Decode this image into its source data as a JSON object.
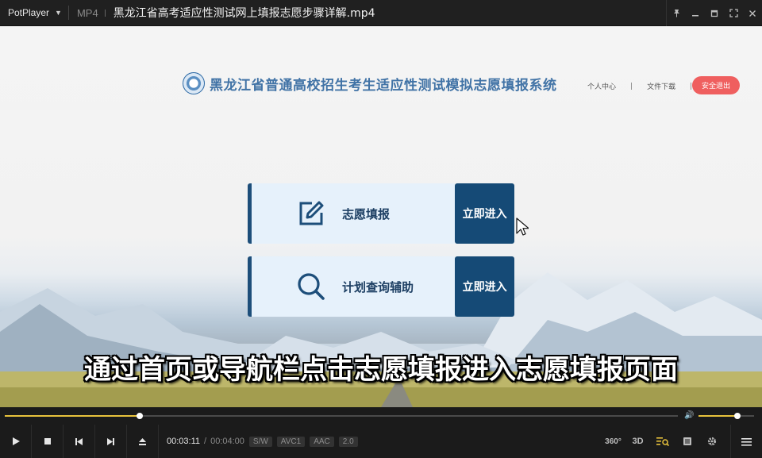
{
  "app": {
    "name": "PotPlayer",
    "format": "MP4",
    "file_title": "黑龙江省高考适应性测试网上填报志愿步骤详解.mp4"
  },
  "video_content": {
    "system_title": "黑龙江省普通高校招生考生适应性测试模拟志愿填报系统",
    "links": [
      "个人中心",
      "文件下载"
    ],
    "link_separator": "|",
    "logout_label": "安全退出",
    "cards": [
      {
        "label": "志愿填报",
        "action": "立即进入",
        "icon": "edit-icon"
      },
      {
        "label": "计划查询辅助",
        "action": "立即进入",
        "icon": "search-icon"
      }
    ],
    "subtitle": "通过首页或导航栏点击志愿填报进入志愿填报页面"
  },
  "playback": {
    "current_time": "00:03:11",
    "time_separator": "/",
    "total_time": "00:04:00",
    "progress": 0.2,
    "volume": 0.7,
    "tags": [
      "S/W",
      "AVC1",
      "AAC",
      "2.0"
    ]
  },
  "right_controls": {
    "vr_label": "360°",
    "3d_label": "3D"
  },
  "colors": {
    "accent": "#e8c23c",
    "card_dark": "#154a76",
    "logout": "#ef5f5f",
    "system_title": "#4173a6"
  }
}
